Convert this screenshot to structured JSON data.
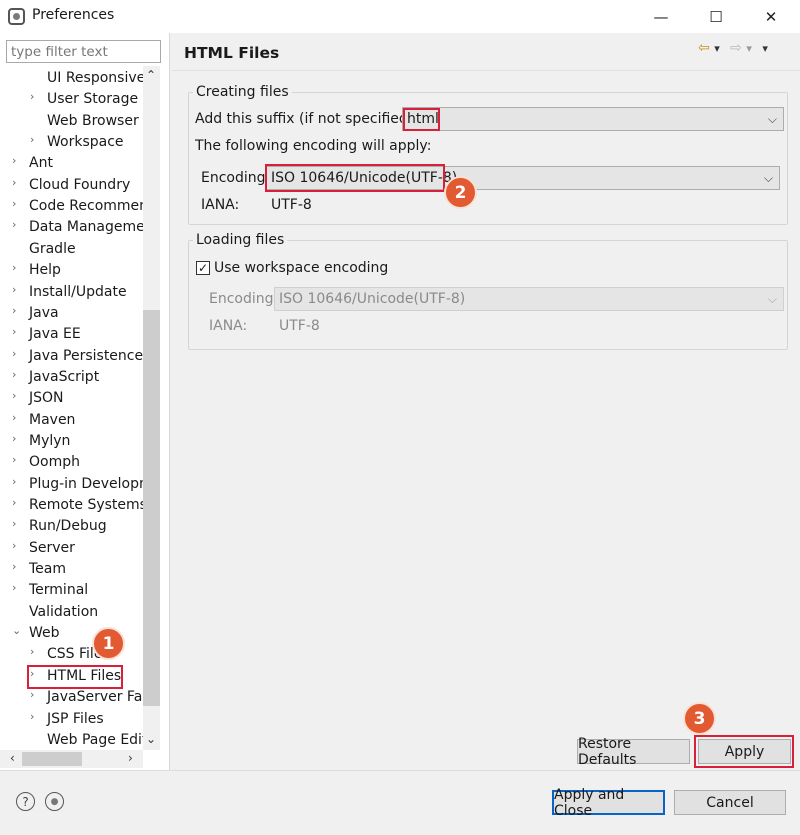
{
  "window": {
    "title": "Preferences",
    "controls": {
      "minimize": "—",
      "maximize": "☐",
      "close": "✕"
    }
  },
  "filter": {
    "placeholder": "type filter text",
    "value": ""
  },
  "tree": {
    "items": [
      {
        "label": "UI Responsiven",
        "level": 2,
        "chevron": ""
      },
      {
        "label": "User Storage Se",
        "level": 2,
        "chevron": "›"
      },
      {
        "label": "Web Browser",
        "level": 2,
        "chevron": ""
      },
      {
        "label": "Workspace",
        "level": 2,
        "chevron": "›"
      },
      {
        "label": "Ant",
        "level": 1,
        "chevron": "›"
      },
      {
        "label": "Cloud Foundry",
        "level": 1,
        "chevron": "›"
      },
      {
        "label": "Code Recommen",
        "level": 1,
        "chevron": "›"
      },
      {
        "label": "Data Managemen",
        "level": 1,
        "chevron": "›"
      },
      {
        "label": "Gradle",
        "level": 1,
        "chevron": ""
      },
      {
        "label": "Help",
        "level": 1,
        "chevron": "›"
      },
      {
        "label": "Install/Update",
        "level": 1,
        "chevron": "›"
      },
      {
        "label": "Java",
        "level": 1,
        "chevron": "›"
      },
      {
        "label": "Java EE",
        "level": 1,
        "chevron": "›"
      },
      {
        "label": "Java Persistence",
        "level": 1,
        "chevron": "›"
      },
      {
        "label": "JavaScript",
        "level": 1,
        "chevron": "›"
      },
      {
        "label": "JSON",
        "level": 1,
        "chevron": "›"
      },
      {
        "label": "Maven",
        "level": 1,
        "chevron": "›"
      },
      {
        "label": "Mylyn",
        "level": 1,
        "chevron": "›"
      },
      {
        "label": "Oomph",
        "level": 1,
        "chevron": "›"
      },
      {
        "label": "Plug-in Developm",
        "level": 1,
        "chevron": "›"
      },
      {
        "label": "Remote Systems",
        "level": 1,
        "chevron": "›"
      },
      {
        "label": "Run/Debug",
        "level": 1,
        "chevron": "›"
      },
      {
        "label": "Server",
        "level": 1,
        "chevron": "›"
      },
      {
        "label": "Team",
        "level": 1,
        "chevron": "›"
      },
      {
        "label": "Terminal",
        "level": 1,
        "chevron": "›"
      },
      {
        "label": "Validation",
        "level": 1,
        "chevron": ""
      },
      {
        "label": "Web",
        "level": 1,
        "chevron": "⌄"
      },
      {
        "label": "CSS Files",
        "level": 2,
        "chevron": "›"
      },
      {
        "label": "HTML Files",
        "level": 2,
        "chevron": "›"
      },
      {
        "label": "JavaServer Faces",
        "level": 2,
        "chevron": "›"
      },
      {
        "label": "JSP Files",
        "level": 2,
        "chevron": "›"
      },
      {
        "label": "Web Page Editor",
        "level": 2,
        "chevron": ""
      }
    ],
    "selected": "HTML Files"
  },
  "page": {
    "title": "HTML Files",
    "nav": {
      "back": "⇦",
      "back_menu": "▾",
      "forward": "⇨",
      "forward_menu": "▾",
      "view_menu": "▾"
    }
  },
  "creating_files": {
    "group_title": "Creating files",
    "suffix_label": "Add this suffix (if not specified):",
    "suffix_value": "html",
    "encoding_intro": "The following encoding will apply:",
    "encoding_label": "Encoding:",
    "encoding_value": "ISO 10646/Unicode(UTF-8)",
    "iana_label": "IANA:",
    "iana_value": "UTF-8"
  },
  "loading_files": {
    "group_title": "Loading files",
    "use_workspace_label": "Use workspace encoding",
    "use_workspace_checked": true,
    "encoding_label": "Encoding:",
    "encoding_value": "ISO 10646/Unicode(UTF-8)",
    "iana_label": "IANA:",
    "iana_value": "UTF-8"
  },
  "buttons": {
    "restore_defaults": "Restore Defaults",
    "apply": "Apply",
    "apply_and_close": "Apply and Close",
    "cancel": "Cancel"
  },
  "annotations": {
    "badge_1": "1",
    "badge_2": "2",
    "badge_3": "3",
    "badge_color": "#e15a32",
    "highlight_color": "#d8203a"
  },
  "footer": {
    "help_icon": "?",
    "info_icon": "●"
  },
  "scrollbar": {
    "up": "⌃",
    "down": "⌄",
    "left": "‹",
    "right": "›"
  }
}
